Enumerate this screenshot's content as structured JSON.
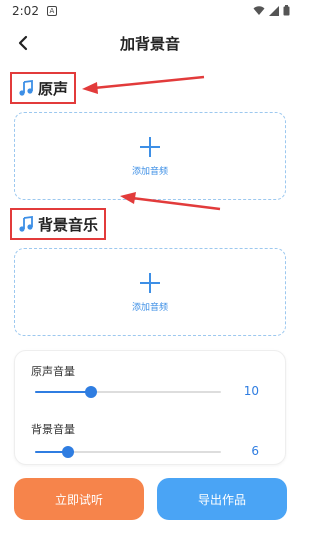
{
  "status_bar": {
    "time": "2:02",
    "badge": "A"
  },
  "header": {
    "title": "加背景音"
  },
  "sections": {
    "original": {
      "label": "原声",
      "upload_hint": "添加音频"
    },
    "background": {
      "label": "背景音乐",
      "upload_hint": "添加音频"
    }
  },
  "volume": {
    "original": {
      "label": "原声音量",
      "value": "10",
      "level": 0.3
    },
    "background": {
      "label": "背景音量",
      "value": "6",
      "level": 0.18
    }
  },
  "buttons": {
    "listen": "立即试听",
    "export": "导出作品"
  },
  "colors": {
    "accent": "#2f7de1",
    "annotation": "#e23b3b",
    "listen": "#f6844b",
    "export": "#4aa4f5"
  },
  "icons": {
    "back": "back-arrow-icon",
    "note": "music-note-icon",
    "add": "plus-icon"
  }
}
